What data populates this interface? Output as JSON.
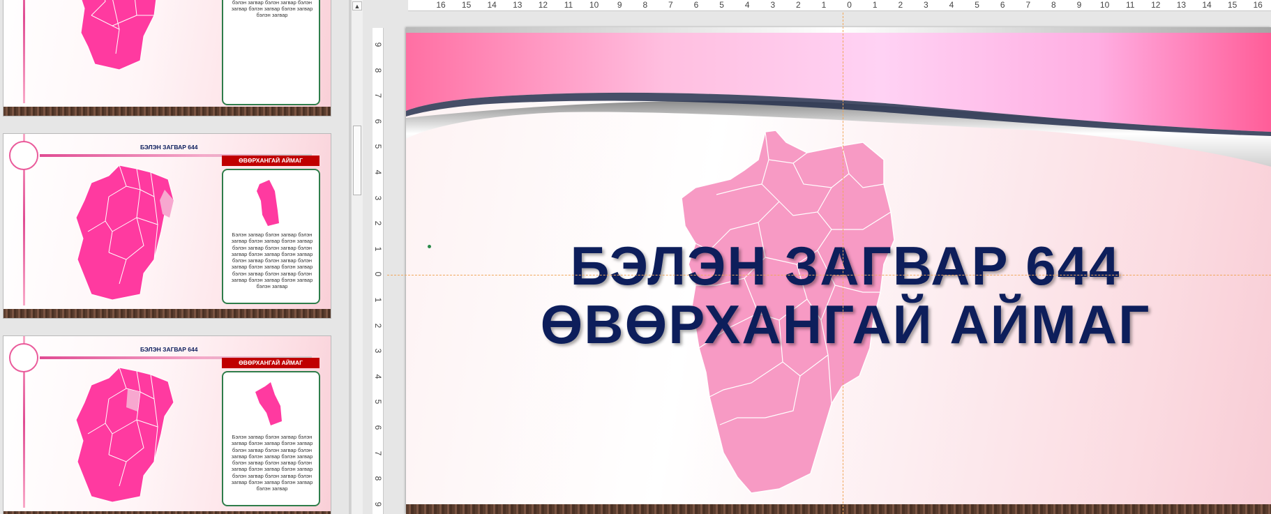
{
  "thumbnails": [
    {
      "title": "",
      "province_label": "",
      "body": "Бэлэн загвар бэлэн загвар бэлэн загвар бэлэн загвар бэлэн загвар бэлэн загвар бэлэн загвар бэлэн загвар бэлэн загвар бэлэн загвар бэлэн загвар бэлэн загвар бэлэн загвар бэлэн загвар бэлэн загвар бэлэн загвар бэлэн загвар бэлэн загвар бэлэн загвар бэлэн загвар бэлэн загвар"
    },
    {
      "title": "БЭЛЭН ЗАГВАР 644",
      "province_label": "ӨВӨРХАНГАЙ АЙМАГ",
      "body": "Бэлэн загвар бэлэн загвар бэлэн загвар бэлэн загвар бэлэн загвар бэлэн загвар бэлэн загвар бэлэн загвар бэлэн загвар бэлэн загвар бэлэн загвар бэлэн загвар бэлэн загвар бэлэн загвар бэлэн загвар бэлэн загвар бэлэн загвар бэлэн загвар бэлэн загвар бэлэн загвар бэлэн загвар"
    },
    {
      "title": "БЭЛЭН ЗАГВАР 644",
      "province_label": "ӨВӨРХАНГАЙ АЙМАГ",
      "body": "Бэлэн загвар бэлэн загвар бэлэн загвар бэлэн загвар бэлэн загвар бэлэн загвар бэлэн загвар бэлэн загвар бэлэн загвар бэлэн загвар бэлэн загвар бэлэн загвар бэлэн загвар бэлэн загвар бэлэн загвар бэлэн загвар бэлэн загвар бэлэн загвар бэлэн загвар бэлэн загвар бэлэн загвар"
    }
  ],
  "slide": {
    "title_line1": "БЭЛЭН ЗАГВАР 644",
    "title_line2": "ӨВӨРХАНГАЙ АЙМАГ"
  },
  "ruler": {
    "horizontal": [
      "16",
      "15",
      "14",
      "13",
      "12",
      "11",
      "10",
      "9",
      "8",
      "7",
      "6",
      "5",
      "4",
      "3",
      "2",
      "1",
      "0",
      "1",
      "2",
      "3",
      "4",
      "5",
      "6",
      "7",
      "8",
      "9",
      "10",
      "11",
      "12",
      "13",
      "14",
      "15",
      "16"
    ],
    "vertical": [
      "9",
      "8",
      "7",
      "6",
      "5",
      "4",
      "3",
      "2",
      "1",
      "0",
      "1",
      "2",
      "3",
      "4",
      "5",
      "6",
      "7",
      "8",
      "9"
    ]
  },
  "colors": {
    "map_pink_thumb": "#ff3aa0",
    "map_pink_slide": "#f79ac4",
    "title_navy": "#0d1e5b",
    "label_red": "#c00000"
  },
  "icons": {
    "scroll_up": "▲"
  }
}
